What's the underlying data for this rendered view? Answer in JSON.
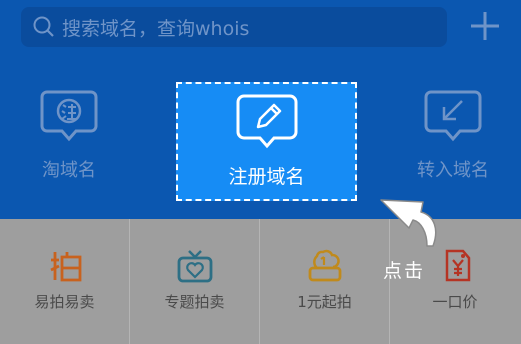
{
  "search": {
    "placeholder": "搜索域名，查询whois"
  },
  "nav": {
    "tao": "淘域名",
    "register": "注册域名",
    "transfer": "转入域名"
  },
  "grid": [
    "易拍易卖",
    "专题拍卖",
    "1元起拍",
    "一口价"
  ],
  "hint": "点击",
  "colors": {
    "header": "#0b57b0",
    "highlight": "#168cf5",
    "grid_bg": "#9e9e9e",
    "orange": "#c8621e",
    "teal": "#2d6f85",
    "gold": "#c08a1c",
    "red": "#b53424"
  }
}
